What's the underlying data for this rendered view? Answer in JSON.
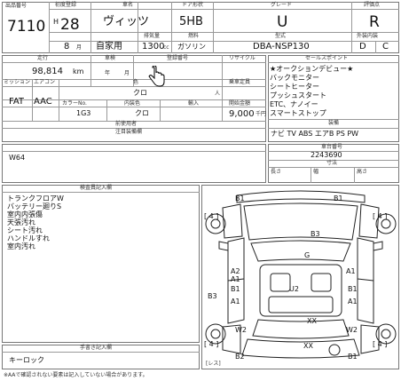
{
  "header": {
    "lot_label": "出品番号",
    "lot": "7110",
    "year_label": "初度登録",
    "era": "H",
    "year": "28",
    "month": "8",
    "month_unit": "月",
    "name_label": "車名",
    "name": "ヴィッツ",
    "door_label": "ドア形状",
    "door": "5HB",
    "grade_label": "グレード",
    "grade": "U",
    "rating_label": "評価点",
    "rating": "R",
    "use": "自家用",
    "disp_label": "排気量",
    "disp": "1300",
    "disp_unit": "cc",
    "fuel_label": "燃料",
    "fuel": "ガソリン",
    "model_label": "型式",
    "model": "DBA-NSP130",
    "ext_label": "外装内装",
    "ext": "D",
    "int": "C"
  },
  "mid": {
    "mileage_label": "走行",
    "mileage": "98,814",
    "mileage_unit": "km",
    "inspection_label": "車検",
    "ins_year": "年",
    "ins_month": "月",
    "reg_label": "登録番号",
    "trans_label": "ミッション",
    "trans": "FAT",
    "ac_label": "エアコン",
    "ac": "AAC",
    "seats_label": "乗車定員",
    "seats_unit": "人",
    "color_label": "色",
    "color": "クロ",
    "color_code_label": "カラーNo.",
    "color_code": "1G3",
    "interior_label": "内装色",
    "interior": "クロ",
    "import_label": "輸入",
    "price_label": "開始金額",
    "price": "9,000",
    "price_unit": "千円",
    "recycle_label": "リサイクル",
    "prev_label": "前使用者",
    "history_label": "注目装備欄"
  },
  "sale_points": {
    "label": "セールスポイント",
    "items": [
      "★オークションデビュー★",
      "バックモニター",
      "シートヒーター",
      "プッシュスタート",
      "ETC、ナノイー",
      "スマートストップ"
    ],
    "equip_label": "装備",
    "equip": "ナビ TV ABS エアB PS PW"
  },
  "notes": {
    "text": "W64",
    "chassis_label": "車台番号",
    "chassis": "2243690",
    "dims_label": "寸法",
    "dims": [
      "長さ",
      "幅",
      "高さ"
    ]
  },
  "inspector": {
    "label": "検査員記入欄",
    "items": [
      "トランクフロアW",
      "バッテリー廻りS",
      "室内内張傷",
      "天張汚れ",
      "シート汚れ",
      "ハンドルすれ",
      "室内汚れ"
    ]
  },
  "remarks": {
    "label": "手書き記入欄",
    "text": "キーロック"
  },
  "diagram": {
    "codes": [
      "B1",
      "B1",
      "B3",
      "G",
      "A2",
      "A1",
      "A1",
      "B3",
      "B1",
      "A1",
      "U2",
      "B1",
      "A1",
      "W2",
      "XX",
      "XX",
      "W2",
      "B2",
      "B1"
    ],
    "brackets": [
      "[ 4 ]",
      "[ 4 ]",
      "[ 4 ]",
      "[ 4 ]"
    ],
    "left_tag": "[レス]"
  },
  "footer_text": "※AAで確認されない要素は記入していない場合があります。"
}
